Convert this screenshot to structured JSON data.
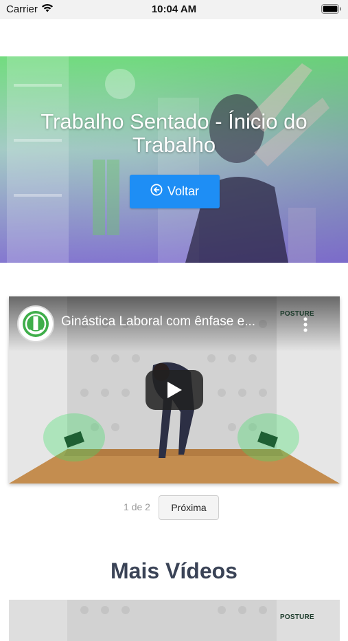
{
  "status_bar": {
    "carrier": "Carrier",
    "time": "10:04 AM"
  },
  "hero": {
    "title": "Trabalho Sentado - Ínicio do Trabalho",
    "back_label": "Voltar"
  },
  "video": {
    "title": "Ginástica Laboral com ênfase e...",
    "channel_logo_text": "POSTURE"
  },
  "pagination": {
    "indicator": "1 de 2",
    "next_label": "Próxima"
  },
  "more_videos": {
    "heading": "Mais Vídeos",
    "thumb_logo_text": "POSTURE"
  },
  "colors": {
    "primary_button": "#1e8ef5",
    "heading": "#3a4356"
  }
}
